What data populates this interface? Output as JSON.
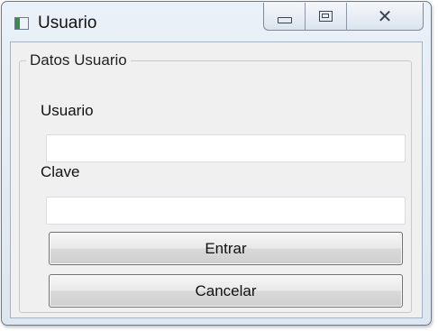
{
  "window": {
    "title": "Usuario",
    "icon": "app-window-icon",
    "caption_buttons": {
      "minimize_icon": "minimize-icon",
      "maximize_icon": "maximize-icon",
      "close_icon": "close-icon",
      "close_glyph": "✕"
    }
  },
  "form": {
    "group_title": "Datos Usuario",
    "usuario_label": "Usuario",
    "usuario_value": "",
    "clave_label": "Clave",
    "clave_value": "",
    "entrar_label": "Entrar",
    "cancelar_label": "Cancelar"
  }
}
